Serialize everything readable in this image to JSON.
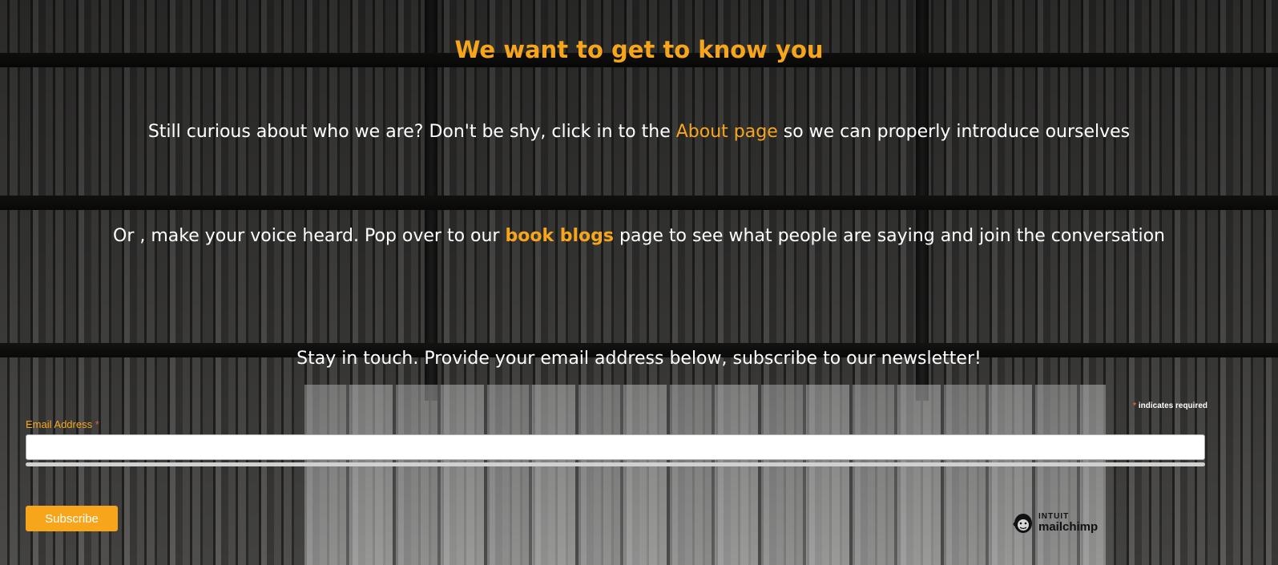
{
  "heading": "We want to get to know you",
  "about_section": {
    "text_before": "Still curious about who we are? Don't be shy, click in to the ",
    "link_label": "About page",
    "text_after": " so we can properly introduce ourselves"
  },
  "blog_section": {
    "text_before": "Or , make your voice heard. Pop over to our ",
    "link_label": "book blogs",
    "text_after": " page to see what people are saying and join the conversation"
  },
  "newsletter": {
    "intro": "Stay in touch. Provide your email address below, subscribe to our newsletter!",
    "required_star": "*",
    "required_note": " indicates required",
    "email_label": "Email Address ",
    "email_value": "",
    "subscribe_label": "Subscribe"
  },
  "badge": {
    "icon": "mailchimp-freddie-icon",
    "line1": "INTUIT",
    "line2": "mailchimp"
  },
  "colors": {
    "accent": "#f7a61b",
    "required": "#e85c41",
    "text": "#ffffff"
  }
}
